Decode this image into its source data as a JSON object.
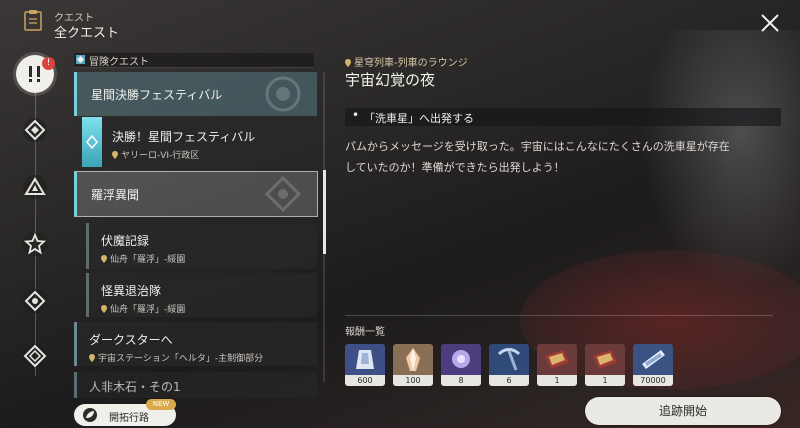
{
  "header": {
    "section_label": "クエスト",
    "title": "全クエスト"
  },
  "sidebar": {
    "badge": "!"
  },
  "quest_list": {
    "category": "冒険クエスト",
    "groups": [
      {
        "title": "星間決勝フェスティバル"
      },
      {
        "title": "羅浮異聞"
      }
    ],
    "items": [
      {
        "title": "決勝！星間フェスティバル",
        "location": "ヤリーロ-VI-行政区"
      },
      {
        "title": "伏魔記録",
        "location": "仙舟「羅浮」-綏園"
      },
      {
        "title": "怪異退治隊",
        "location": "仙舟「羅浮」-綏園"
      },
      {
        "title": "ダークスターへ",
        "location": "宇宙ステーション「ヘルタ」-主制御部分"
      },
      {
        "title": "人非木石・その1"
      }
    ],
    "new_badge": "NEW",
    "bottom_button": "開拓行路"
  },
  "detail": {
    "location": "星穹列車-列車のラウンジ",
    "title": "宇宙幻覚の夜",
    "objective": "「洗車星」へ出発する",
    "description_line1": "パムからメッセージを受け取った。宇宙にはこんなにたくさんの洗車星が存在",
    "description_line2": "していたのか！準備ができたら出発しよう！",
    "rewards_label": "報酬一覧",
    "rewards": [
      {
        "count": "600",
        "icon": "stellar-jade-icon"
      },
      {
        "count": "100",
        "icon": "crystal-icon"
      },
      {
        "count": "8",
        "icon": "purple-material-icon"
      },
      {
        "count": "6",
        "icon": "pickaxe-material-icon"
      },
      {
        "count": "1",
        "icon": "red-book-icon"
      },
      {
        "count": "1",
        "icon": "red-book-icon"
      },
      {
        "count": "70000",
        "icon": "credit-icon"
      }
    ],
    "track_button": "追跡開始"
  },
  "colors": {
    "accent": "#77d0dd",
    "badge": "#d9443c",
    "location_gold": "#d6c7a6"
  }
}
